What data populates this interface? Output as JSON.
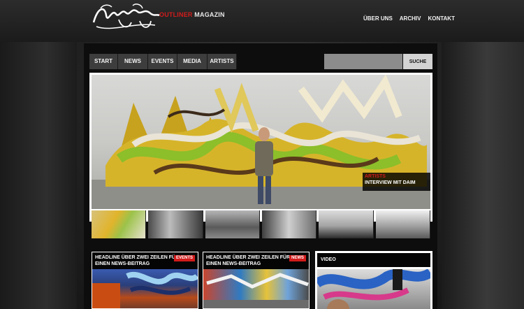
{
  "brand": {
    "name_part1": "OUTLINER",
    "name_part2": " MAGAZIN",
    "accent_color": "#d21b1b"
  },
  "top_nav": [
    "ÜBER UNS",
    "ARCHIV",
    "KONTAKT"
  ],
  "main_nav": [
    "START",
    "NEWS",
    "EVENTS",
    "MEDIA",
    "ARTISTS"
  ],
  "search": {
    "placeholder": "",
    "button_label": "SUCHE"
  },
  "hero": {
    "category": "ARTISTS",
    "title": "INTERVIEW MIT DAIM"
  },
  "news": [
    {
      "headline": "HEADLINE ÜBER ZWEI ZEILEN FÜR EINEN NEWS-BEITRAG",
      "badge": "EVENTS"
    },
    {
      "headline": "HEADLINE ÜBER ZWEI ZEILEN FÜR EINEN NEWS-BEITRAG",
      "badge": "NEWS"
    }
  ],
  "video": {
    "title": "VIDEO"
  }
}
